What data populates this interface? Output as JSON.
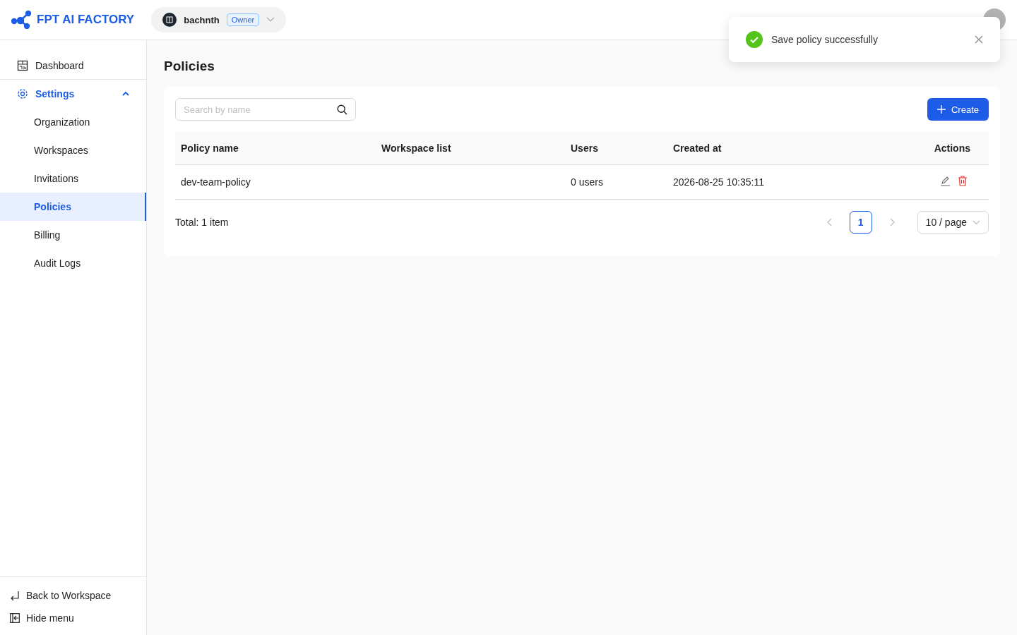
{
  "brand": {
    "name": "FPT AI FACTORY"
  },
  "org": {
    "name": "bachnth",
    "role": "Owner"
  },
  "toast": {
    "message": "Save policy successfully"
  },
  "sidebar": {
    "items": [
      {
        "label": "Dashboard",
        "kind": "top",
        "selected": false
      },
      {
        "label": "Settings",
        "kind": "group",
        "expanded": true,
        "selected": false
      },
      {
        "label": "Organization",
        "kind": "sub",
        "selected": false
      },
      {
        "label": "Workspaces",
        "kind": "sub",
        "selected": false
      },
      {
        "label": "Invitations",
        "kind": "sub",
        "selected": false
      },
      {
        "label": "Policies",
        "kind": "sub",
        "selected": true
      },
      {
        "label": "Billing",
        "kind": "sub",
        "selected": false
      },
      {
        "label": "Audit Logs",
        "kind": "sub",
        "selected": false
      }
    ],
    "footer": [
      {
        "label": "Back to Workspace",
        "kind": "back"
      },
      {
        "label": "Hide menu",
        "kind": "hide"
      }
    ]
  },
  "page": {
    "title": "Policies"
  },
  "search": {
    "placeholder": "Search by name"
  },
  "create_button": {
    "label": "Create"
  },
  "table": {
    "columns": [
      "Policy name",
      "Workspace list",
      "Users",
      "Created at",
      "Actions"
    ],
    "rows": [
      {
        "policy_name": "dev-team-policy",
        "workspace_list": "",
        "users": "0 users",
        "created_at": "2026-08-25 10:35:11"
      }
    ]
  },
  "pagination": {
    "total": "Total: 1 item",
    "pages": [
      {
        "label": "1",
        "selected": true
      }
    ],
    "page_size": "10 / page"
  }
}
